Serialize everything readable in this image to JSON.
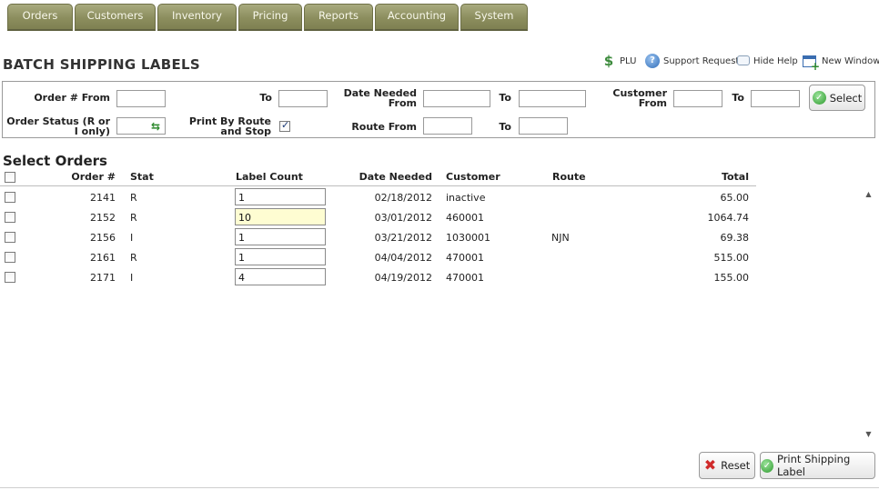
{
  "nav": {
    "tabs": [
      {
        "label": "Orders"
      },
      {
        "label": "Customers"
      },
      {
        "label": "Inventory"
      },
      {
        "label": "Pricing"
      },
      {
        "label": "Reports"
      },
      {
        "label": "Accounting"
      },
      {
        "label": "System"
      }
    ]
  },
  "header": {
    "title": "BATCH SHIPPING LABELS",
    "links": {
      "plu": "PLU",
      "support": "Support Request",
      "hide_help": "Hide Help",
      "new_window": "New Window"
    }
  },
  "filter": {
    "order_from_label": "Order # From",
    "order_to_label": "To",
    "date_needed_from_label": "Date Needed From",
    "date_needed_to_label": "To",
    "customer_from_label": "Customer From",
    "customer_to_label": "To",
    "order_status_label": "Order Status (R or I only)",
    "print_by_route_label": "Print By Route and Stop",
    "print_by_route_checked": true,
    "route_from_label": "Route From",
    "route_to_label": "To",
    "order_from_value": "",
    "order_to_value": "",
    "date_from_value": "",
    "date_to_value": "",
    "customer_from_value": "",
    "customer_to_value": "",
    "order_status_value": "",
    "route_from_value": "",
    "route_to_value": "",
    "select_button": "Select"
  },
  "orders": {
    "title": "Select Orders",
    "columns": {
      "order": "Order #",
      "stat": "Stat",
      "label_count": "Label Count",
      "date_needed": "Date Needed",
      "customer": "Customer",
      "route": "Route",
      "total": "Total"
    },
    "rows": [
      {
        "order": "2141",
        "stat": "R",
        "label_count": "1",
        "date_needed": "02/18/2012",
        "customer": "inactive",
        "route": "",
        "total": "65.00",
        "focused": false
      },
      {
        "order": "2152",
        "stat": "R",
        "label_count": "10",
        "date_needed": "03/01/2012",
        "customer": "460001",
        "route": "",
        "total": "1064.74",
        "focused": true
      },
      {
        "order": "2156",
        "stat": "I",
        "label_count": "1",
        "date_needed": "03/21/2012",
        "customer": "1030001",
        "route": "NJN",
        "total": "69.38",
        "focused": false
      },
      {
        "order": "2161",
        "stat": "R",
        "label_count": "1",
        "date_needed": "04/04/2012",
        "customer": "470001",
        "route": "",
        "total": "515.00",
        "focused": false
      },
      {
        "order": "2171",
        "stat": "I",
        "label_count": "4",
        "date_needed": "04/19/2012",
        "customer": "470001",
        "route": "",
        "total": "155.00",
        "focused": false
      }
    ]
  },
  "actions": {
    "reset": "Reset",
    "print": "Print Shipping Label"
  },
  "colors": {
    "tab_bg": "#8c8e5e",
    "focus_field": "#fefdd2",
    "ok_green": "#2e9a2e",
    "reset_red": "#d02a2a"
  }
}
